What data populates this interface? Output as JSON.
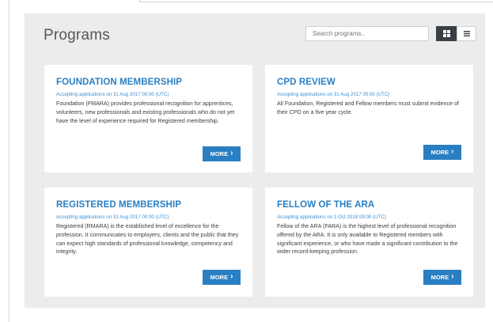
{
  "header": {
    "title": "Programs",
    "search_placeholder": "Search programs..",
    "grid_view_icon": "grid-icon",
    "list_view_icon": "list-icon"
  },
  "cards": [
    {
      "title": "FOUNDATION MEMBERSHIP",
      "meta": "Accepting applications on 31 Aug 2017 00:00 (UTC)",
      "description": "Foundation (FMARA) provides professional recognition for apprentices, volunteers, new professionals and existing professionals who do not yet have the level of experience required for Registered membership.",
      "button": "MORE"
    },
    {
      "title": "CPD REVIEW",
      "meta": "Accepting applications on 31 Aug 2017 00:00 (UTC)",
      "description": "All Foundation, Registered and Fellow members must submit evidence of their CPD on a five year cycle.",
      "button": "MORE"
    },
    {
      "title": "REGISTERED MEMBERSHIP",
      "meta": "Accepting applications on 31 Aug 2017 00:00 (UTC)",
      "description": "Registered (RMARA) is the established level of excellence for the profession. It communicates to employers, clients and the public that they can expect high standards of professional knowledge, competency and integrity.",
      "button": "MORE"
    },
    {
      "title": "FELLOW OF THE ARA",
      "meta": "Accepting applications on 1 Oct 2018 09:00 (UTC)",
      "description": "Fellow of the ARA (FARA) is the highest level of professional recognition offered by the ARA. It is only available to Registered members with significant experience, or who have made a significant contribution to the wider record-keeping profession.",
      "button": "MORE"
    }
  ],
  "colors": {
    "accent": "#2a7fc3",
    "panel_bg": "#ececec",
    "dark_button": "#3a3f46"
  }
}
